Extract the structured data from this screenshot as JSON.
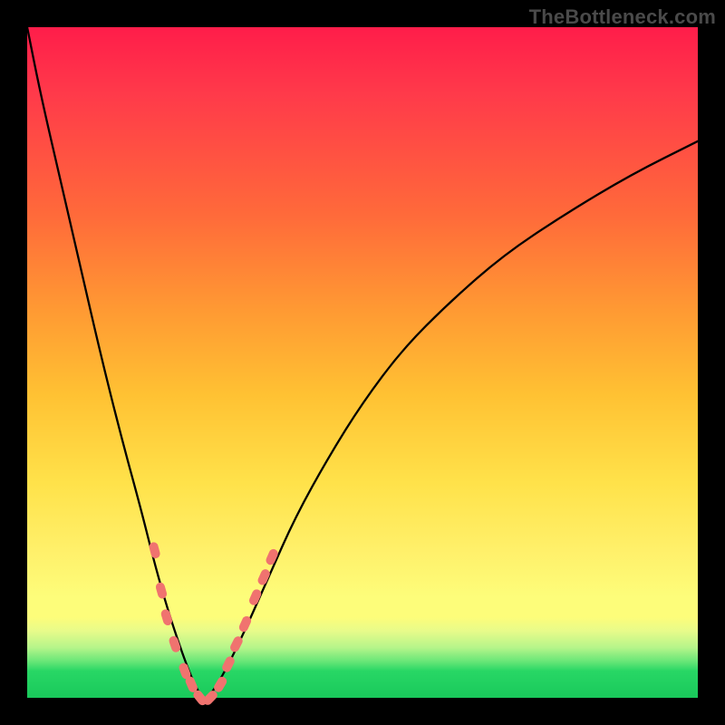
{
  "watermark": "TheBottleneck.com",
  "colors": {
    "gradient_top": "#ff1d4a",
    "gradient_mid": "#ffe24a",
    "gradient_bottom": "#19c95b",
    "curve": "#000000",
    "marker": "#f0736f",
    "frame": "#000000"
  },
  "chart_data": {
    "type": "line",
    "title": "",
    "xlabel": "",
    "ylabel": "",
    "xlim": [
      0,
      100
    ],
    "ylim": [
      0,
      100
    ],
    "background": "red-to-green vertical gradient (bottleneck heatmap)",
    "series": [
      {
        "name": "bottleneck-curve",
        "x": [
          0,
          2,
          5,
          8,
          11,
          14,
          17,
          19,
          21,
          23,
          24.5,
          26,
          27,
          29,
          32,
          36,
          40,
          45,
          50,
          56,
          63,
          71,
          80,
          90,
          100
        ],
        "y": [
          100,
          90,
          77,
          64,
          51,
          39,
          28,
          20,
          13,
          7,
          3,
          0,
          0,
          3,
          9,
          18,
          27,
          36,
          44,
          52,
          59,
          66,
          72,
          78,
          83
        ]
      }
    ],
    "markers": [
      {
        "name": "left-cluster",
        "x": 19.0,
        "y": 22
      },
      {
        "name": "left-cluster",
        "x": 20.0,
        "y": 16
      },
      {
        "name": "left-cluster",
        "x": 20.8,
        "y": 12
      },
      {
        "name": "left-cluster",
        "x": 22.0,
        "y": 8
      },
      {
        "name": "left-cluster",
        "x": 23.5,
        "y": 4
      },
      {
        "name": "left-cluster",
        "x": 24.5,
        "y": 2
      },
      {
        "name": "valley",
        "x": 25.8,
        "y": 0
      },
      {
        "name": "valley",
        "x": 27.3,
        "y": 0
      },
      {
        "name": "right-cluster",
        "x": 28.8,
        "y": 2
      },
      {
        "name": "right-cluster",
        "x": 30.0,
        "y": 5
      },
      {
        "name": "right-cluster",
        "x": 31.2,
        "y": 8
      },
      {
        "name": "right-cluster",
        "x": 32.5,
        "y": 11
      },
      {
        "name": "right-cluster",
        "x": 34.0,
        "y": 15
      },
      {
        "name": "right-cluster",
        "x": 35.3,
        "y": 18
      },
      {
        "name": "right-cluster",
        "x": 36.5,
        "y": 21
      }
    ]
  }
}
